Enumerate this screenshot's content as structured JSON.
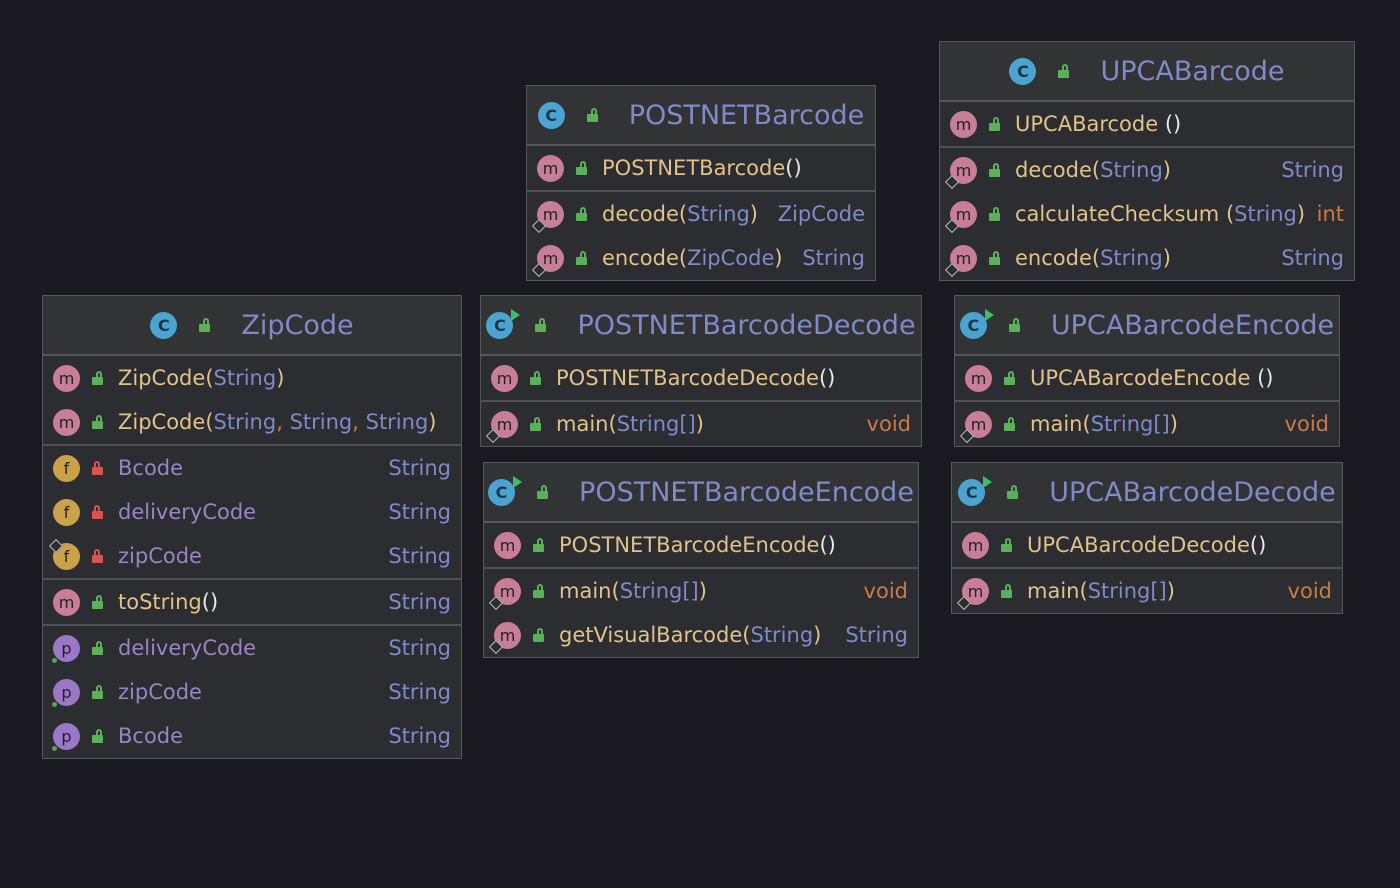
{
  "classes": {
    "postnetbarcode": {
      "name": "POSTNETBarcode",
      "members": [
        {
          "name": "POSTNETBarcode",
          "params": "",
          "ret": ""
        },
        {
          "name": "decode",
          "params": "String",
          "ret": "ZipCode"
        },
        {
          "name": "encode",
          "params": "ZipCode",
          "ret": "String"
        }
      ]
    },
    "upcabarcode": {
      "name": "UPCABarcode",
      "members": [
        {
          "name": "UPCABarcode ",
          "params": "",
          "ret": ""
        },
        {
          "name": "decode",
          "params": "String",
          "ret": "String"
        },
        {
          "name": "calculateChecksum ",
          "params": "String",
          "ret": "int"
        },
        {
          "name": "encode",
          "params": "String",
          "ret": "String"
        }
      ]
    },
    "zipcode": {
      "name": "ZipCode",
      "constructors": [
        {
          "name": "ZipCode",
          "params": [
            "String"
          ]
        },
        {
          "name": "ZipCode",
          "params": [
            "String",
            "String",
            "String"
          ]
        }
      ],
      "fields": [
        {
          "name": "Bcode",
          "type": "String"
        },
        {
          "name": "deliveryCode",
          "type": "String"
        },
        {
          "name": "zipCode",
          "type": "String"
        }
      ],
      "methods": [
        {
          "name": "toString",
          "ret": "String"
        }
      ],
      "properties": [
        {
          "name": "deliveryCode",
          "type": "String"
        },
        {
          "name": "zipCode",
          "type": "String"
        },
        {
          "name": "Bcode",
          "type": "String"
        }
      ]
    },
    "postnetdecode": {
      "name": "POSTNETBarcodeDecode",
      "members": [
        {
          "name": "POSTNETBarcodeDecode",
          "params": "",
          "ret": ""
        },
        {
          "name": "main",
          "params": "String[]",
          "ret": "void"
        }
      ]
    },
    "postnetencode": {
      "name": "POSTNETBarcodeEncode",
      "members": [
        {
          "name": "POSTNETBarcodeEncode",
          "params": "",
          "ret": ""
        },
        {
          "name": "main",
          "params": "String[]",
          "ret": "void"
        },
        {
          "name": "getVisualBarcode",
          "params": "String",
          "ret": "String"
        }
      ]
    },
    "upcaencode": {
      "name": "UPCABarcodeEncode",
      "members": [
        {
          "name": "UPCABarcodeEncode ",
          "params": "",
          "ret": ""
        },
        {
          "name": "main",
          "params": "String[]",
          "ret": "void"
        }
      ]
    },
    "upcadecode": {
      "name": "UPCABarcodeDecode",
      "members": [
        {
          "name": "UPCABarcodeDecode",
          "params": "",
          "ret": ""
        },
        {
          "name": "main",
          "params": "String[]",
          "ret": "void"
        }
      ]
    }
  },
  "icons": {
    "class": "C",
    "method": "m",
    "field": "f",
    "property": "p",
    "paren_open": "(",
    "paren_close": ")",
    "empty_parens": "()",
    "comma": ","
  },
  "colors": {
    "background": "#19191f",
    "class_name": "#7f8ac8",
    "method_name": "#e2c28a",
    "field_name": "#9a84c3",
    "primitive_type": "#cc7a45",
    "public": "#5ab158",
    "private": "#d9534f"
  }
}
